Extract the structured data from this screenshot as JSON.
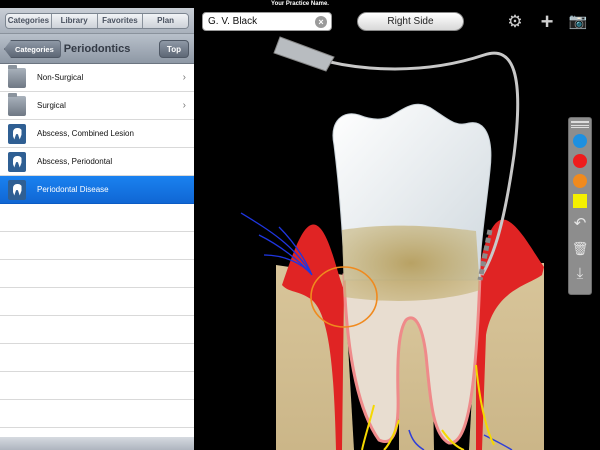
{
  "status_bar": {
    "title": "Your Practice Name."
  },
  "left_panel": {
    "segments": [
      "Categories",
      "Library",
      "Favorites",
      "Plan"
    ],
    "nav": {
      "back_label": "Categories",
      "title": "Periodontics",
      "top_label": "Top"
    },
    "items": [
      {
        "label": "Non-Surgical",
        "icon": "folder-icon",
        "chevron": "›"
      },
      {
        "label": "Surgical",
        "icon": "folder-icon",
        "chevron": "›"
      },
      {
        "label": "Abscess, Combined Lesion",
        "icon": "tooth-icon"
      },
      {
        "label": "Abscess, Periodontal",
        "icon": "tooth-icon"
      },
      {
        "label": "Periodontal Disease",
        "icon": "tooth-icon",
        "selected": true
      }
    ]
  },
  "toolbar": {
    "patient_name": "G. V. Black",
    "clear_symbol": "×",
    "view_label": "Right Side",
    "icons": {
      "settings": "⚙",
      "add": "+",
      "camera": "📷"
    }
  },
  "palette": {
    "colors": [
      "#1e90e0",
      "#ee1c1c",
      "#f08a1e",
      "#f5f000"
    ],
    "tools": {
      "undo": "↶",
      "trash": "🗑",
      "save": "⤓"
    }
  }
}
